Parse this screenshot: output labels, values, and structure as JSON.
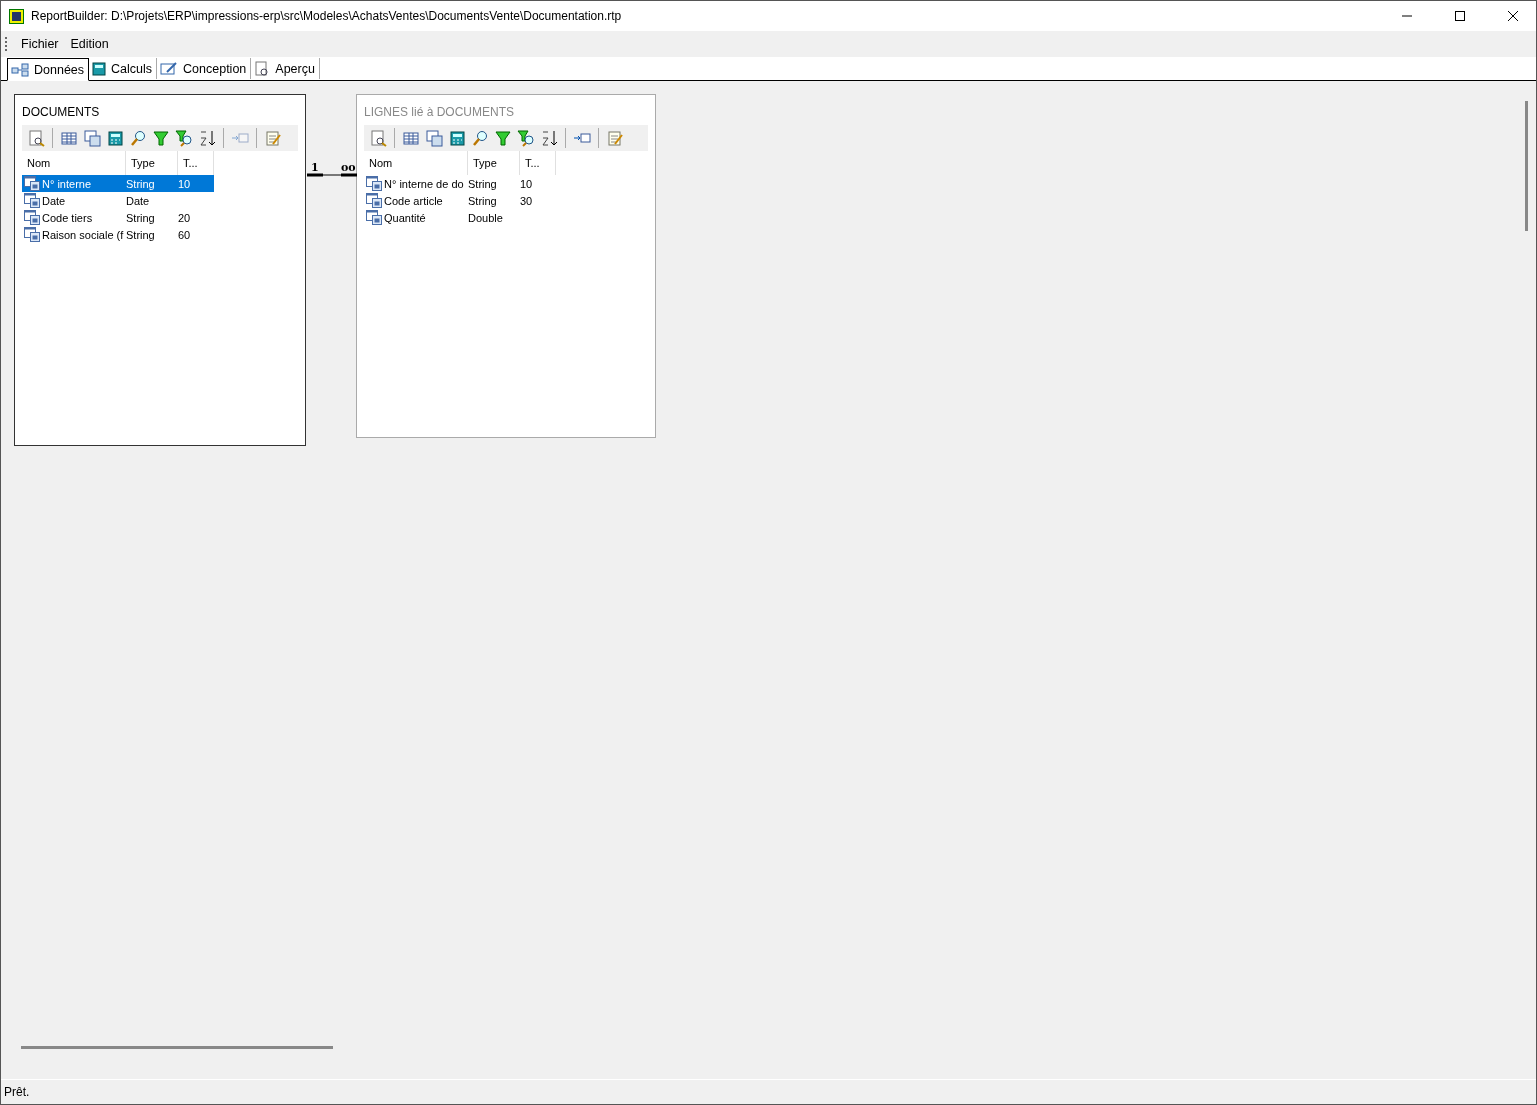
{
  "window": {
    "title": "ReportBuilder: D:\\Projets\\ERP\\impressions-erp\\src\\Modeles\\AchatsVentes\\DocumentsVente\\Documentation.rtp"
  },
  "menu": [
    {
      "label": "Fichier"
    },
    {
      "label": "Edition"
    }
  ],
  "tabs": [
    {
      "label": "Données",
      "selected": true,
      "kind": "data"
    },
    {
      "label": "Calculs",
      "selected": false,
      "kind": "calc"
    },
    {
      "label": "Conception",
      "selected": false,
      "kind": "design"
    },
    {
      "label": "Aperçu",
      "selected": false,
      "kind": "preview"
    }
  ],
  "tables": [
    {
      "title": "DOCUMENTS",
      "active": true,
      "link_enabled": false,
      "columns": [
        "Nom",
        "Type",
        "T..."
      ],
      "rows": [
        {
          "cells": [
            "N° interne",
            "String",
            "10"
          ],
          "selected": true
        },
        {
          "cells": [
            "Date",
            "Date",
            ""
          ],
          "selected": false
        },
        {
          "cells": [
            "Code tiers",
            "String",
            "20"
          ],
          "selected": false
        },
        {
          "cells": [
            "Raison sociale (f",
            "String",
            "60"
          ],
          "selected": false
        }
      ]
    },
    {
      "title": "LIGNES lié à DOCUMENTS",
      "active": false,
      "link_enabled": true,
      "columns": [
        "Nom",
        "Type",
        "T..."
      ],
      "rows": [
        {
          "cells": [
            "N° interne de do",
            "String",
            "10"
          ],
          "selected": false
        },
        {
          "cells": [
            "Code article",
            "String",
            "30"
          ],
          "selected": false
        },
        {
          "cells": [
            "Quantité",
            "Double",
            ""
          ],
          "selected": false
        }
      ]
    }
  ],
  "join": {
    "from_label": "1",
    "to_label": "oo"
  },
  "status_bar": {
    "text": "Prêt."
  }
}
